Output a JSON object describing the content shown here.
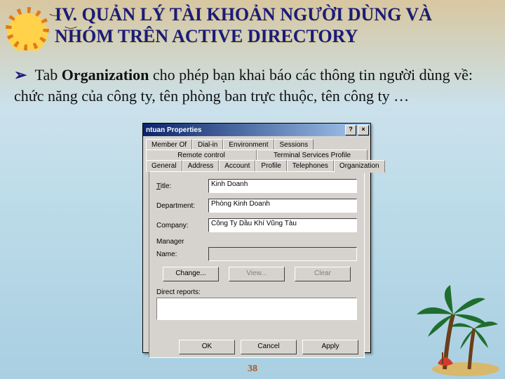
{
  "heading": "IV. QUẢN LÝ TÀI KHOẢN NGƯỜI DÙNG VÀ NHÓM TRÊN ACTIVE DIRECTORY",
  "bullet": {
    "arrow": "➢",
    "prefix": "Tab ",
    "bold": "Organization",
    "rest": " cho phép bạn khai báo các thông tin người dùng về: chức năng của công ty, tên phòng ban trực thuộc, tên công ty …"
  },
  "dialog": {
    "title": "ntuan Properties",
    "help_btn": "?",
    "close_btn": "×",
    "tabs_row1": [
      "Member Of",
      "Dial-in",
      "Environment",
      "Sessions"
    ],
    "tabs_row2": [
      "Remote control",
      "Terminal Services Profile"
    ],
    "tabs_row3": [
      "General",
      "Address",
      "Account",
      "Profile",
      "Telephones",
      "Organization"
    ],
    "active_tab": "Organization",
    "fields": {
      "title_label": "Title:",
      "title_value": "Kinh Doanh",
      "dept_label": "Department:",
      "dept_value": "Phòng Kinh Doanh",
      "company_label": "Company:",
      "company_value": "Công Ty Dầu Khí Vũng Tàu"
    },
    "manager": {
      "label": "Manager",
      "name_label": "Name:",
      "name_value": "",
      "change": "Change...",
      "view": "View...",
      "clear": "Clear"
    },
    "direct_reports_label": "Direct reports:",
    "buttons": {
      "ok": "OK",
      "cancel": "Cancel",
      "apply": "Apply"
    }
  },
  "page_number": "38"
}
